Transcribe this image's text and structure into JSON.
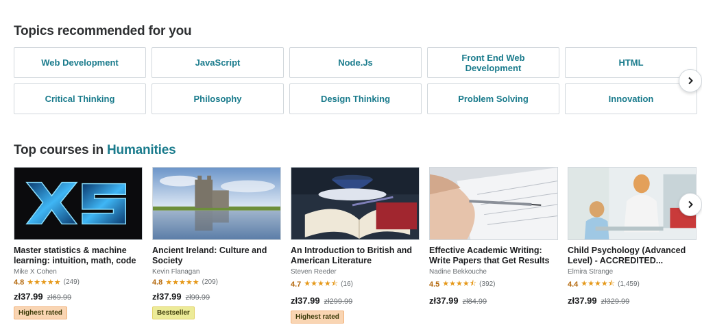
{
  "topics": {
    "title": "Topics recommended for you",
    "items": [
      "Web Development",
      "JavaScript",
      "Node.Js",
      "Front End Web Development",
      "HTML",
      "Critical Thinking",
      "Philosophy",
      "Design Thinking",
      "Problem Solving",
      "Innovation"
    ]
  },
  "courses_section": {
    "title_prefix": "Top courses in",
    "title_accent": "Humanities"
  },
  "courses": [
    {
      "title": "Master statistics & machine learning: intuition, math, code",
      "author": "Mike X Cohen",
      "rating": "4.8",
      "stars": "★★★★★",
      "count": "(249)",
      "price": "zł37.99",
      "old_price": "zł69.99",
      "badge": "Highest rated"
    },
    {
      "title": "Ancient Ireland: Culture and Society",
      "author": "Kevin Flanagan",
      "rating": "4.8",
      "stars": "★★★★★",
      "count": "(209)",
      "price": "zł37.99",
      "old_price": "zł99.99",
      "badge": "Bestseller"
    },
    {
      "title": "An Introduction to British and American Literature",
      "author": "Steven Reeder",
      "rating": "4.7",
      "stars": "★★★★⯪",
      "count": "(16)",
      "price": "zł37.99",
      "old_price": "zł299.99",
      "badge": "Highest rated"
    },
    {
      "title": "Effective Academic Writing: Write Papers that Get Results",
      "author": "Nadine Bekkouche",
      "rating": "4.5",
      "stars": "★★★★⯪",
      "count": "(392)",
      "price": "zł37.99",
      "old_price": "zł84.99",
      "badge": ""
    },
    {
      "title": "Child Psychology (Advanced Level) - ACCREDITED...",
      "author": "Elmira Strange",
      "rating": "4.4",
      "stars": "★★★★⯪",
      "count": "(1,459)",
      "price": "zł37.99",
      "old_price": "zł329.99",
      "badge": ""
    }
  ],
  "icons": {
    "next": "chevron-right-icon"
  },
  "colors": {
    "accent": "#1a7b8c",
    "rating": "#b4690e",
    "star": "#e59819"
  }
}
